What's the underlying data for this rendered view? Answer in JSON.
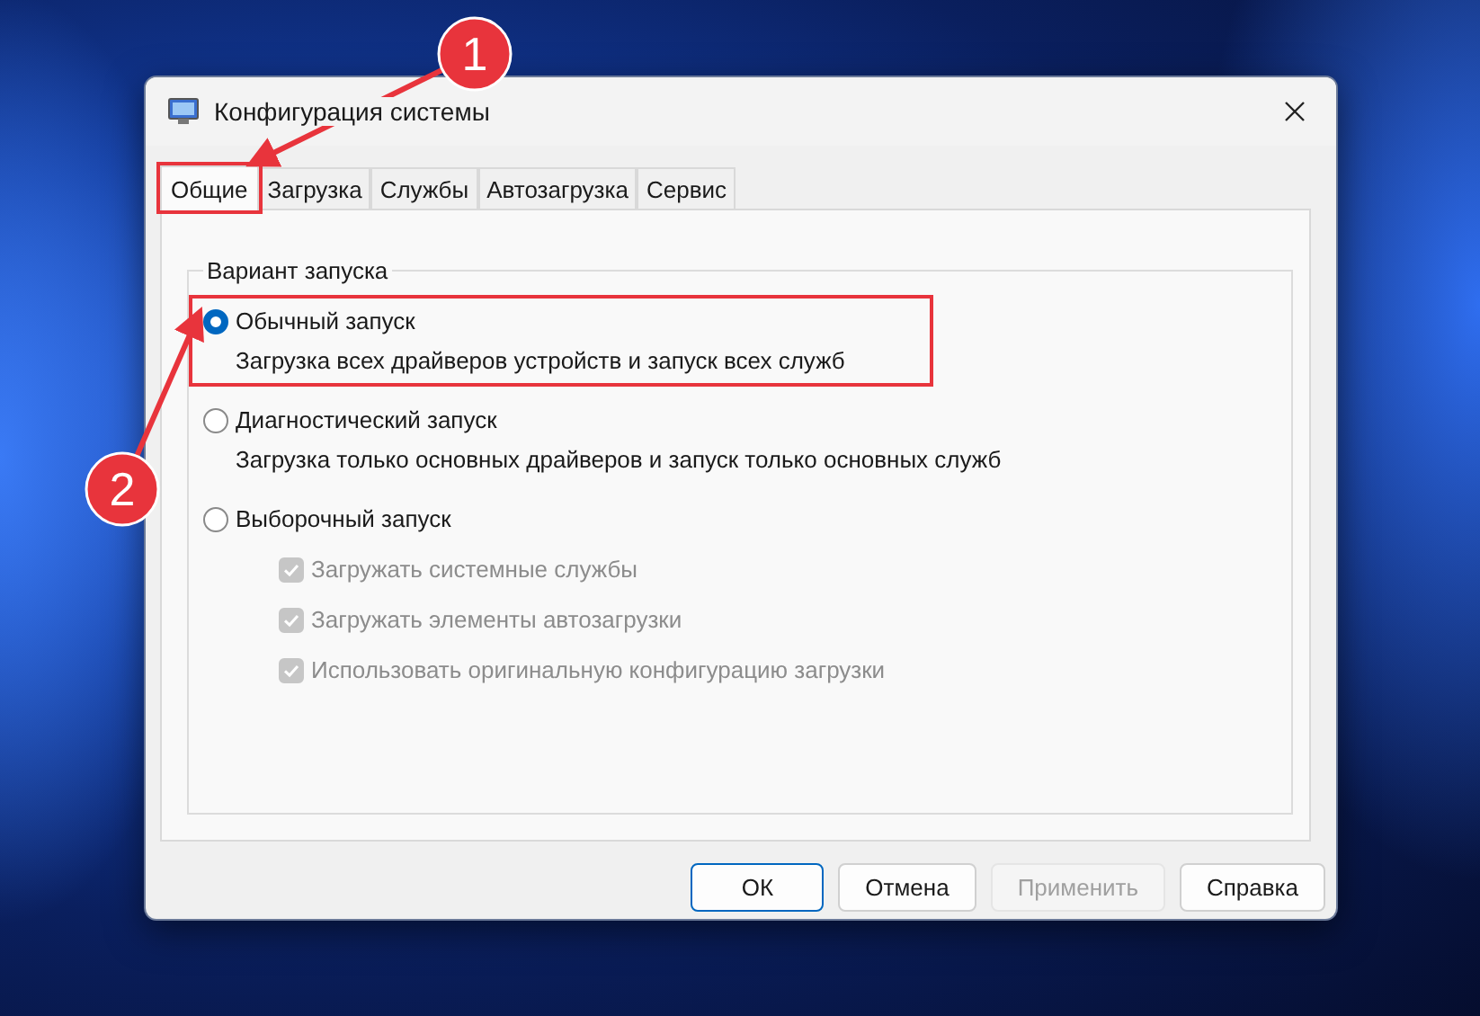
{
  "window": {
    "title": "Конфигурация системы"
  },
  "tabs": [
    {
      "label": "Общие",
      "selected": true,
      "highlighted": true
    },
    {
      "label": "Загрузка",
      "selected": false,
      "highlighted": false
    },
    {
      "label": "Службы",
      "selected": false,
      "highlighted": false
    },
    {
      "label": "Автозагрузка",
      "selected": false,
      "highlighted": false
    },
    {
      "label": "Сервис",
      "selected": false,
      "highlighted": false
    }
  ],
  "group": {
    "label": "Вариант запуска"
  },
  "options": [
    {
      "label": "Обычный запуск",
      "description": "Загрузка всех драйверов устройств и запуск всех служб",
      "selected": true,
      "highlighted": true
    },
    {
      "label": "Диагностический запуск",
      "description": "Загрузка только основных драйверов и запуск только основных служб",
      "selected": false,
      "highlighted": false
    },
    {
      "label": "Выборочный запуск",
      "selected": false,
      "highlighted": false
    }
  ],
  "checkboxes": [
    {
      "label": "Загружать системные службы",
      "checked": true,
      "disabled": true
    },
    {
      "label": "Загружать элементы автозагрузки",
      "checked": true,
      "disabled": true
    },
    {
      "label": "Использовать оригинальную конфигурацию загрузки",
      "checked": true,
      "disabled": true
    }
  ],
  "buttons": [
    {
      "label": "ОК",
      "default": true,
      "disabled": false
    },
    {
      "label": "Отмена",
      "default": false,
      "disabled": false
    },
    {
      "label": "Применить",
      "default": false,
      "disabled": true
    },
    {
      "label": "Справка",
      "default": false,
      "disabled": false
    }
  ],
  "callouts": [
    {
      "number": "1"
    },
    {
      "number": "2"
    }
  ]
}
